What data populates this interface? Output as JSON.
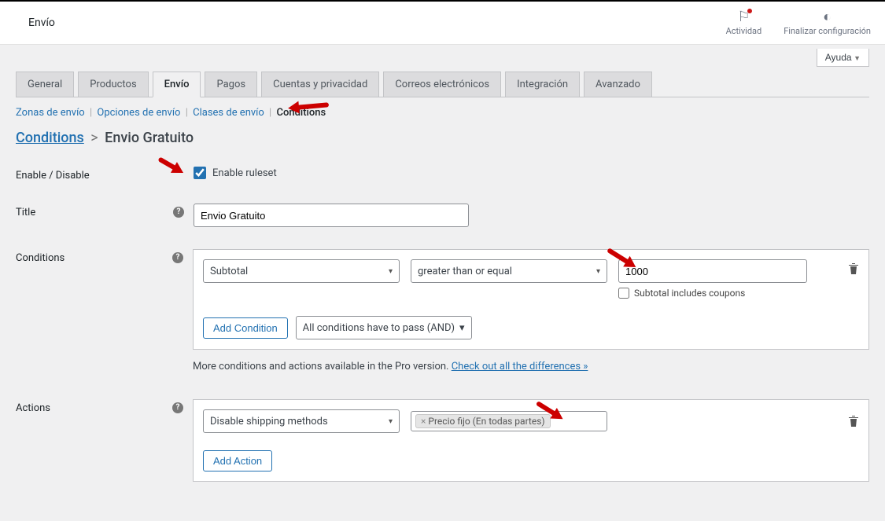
{
  "header": {
    "title": "Envío",
    "actividad_label": "Actividad",
    "finalizar_label": "Finalizar configuración",
    "help_label": "Ayuda"
  },
  "tabs": {
    "items": [
      {
        "label": "General",
        "active": false
      },
      {
        "label": "Productos",
        "active": false
      },
      {
        "label": "Envío",
        "active": true
      },
      {
        "label": "Pagos",
        "active": false
      },
      {
        "label": "Cuentas y privacidad",
        "active": false
      },
      {
        "label": "Correos electrónicos",
        "active": false
      },
      {
        "label": "Integración",
        "active": false
      },
      {
        "label": "Avanzado",
        "active": false
      }
    ]
  },
  "subtabs": {
    "zonas": "Zonas de envío",
    "opciones": "Opciones de envío",
    "clases": "Clases de envío",
    "conditions": "Conditions"
  },
  "breadcrumb": {
    "root": "Conditions",
    "current": "Envio Gratuito"
  },
  "form": {
    "enable_label": "Enable / Disable",
    "enable_checkbox_label": "Enable ruleset",
    "enable_checked": true,
    "title_label": "Title",
    "title_value": "Envio Gratuito",
    "conditions_label": "Conditions",
    "actions_label": "Actions"
  },
  "condition": {
    "field": "Subtotal",
    "operator": "greater than or equal",
    "value": "1000",
    "sub_option_label": "Subtotal includes coupons",
    "sub_option_checked": false,
    "add_button": "Add Condition",
    "logic_selector": "All conditions have to pass (AND)"
  },
  "pro_note": {
    "text": "More conditions and actions available in the Pro version. ",
    "link": "Check out all the differences »"
  },
  "action": {
    "type": "Disable shipping methods",
    "tag": "Precio fijo (En todas partes)",
    "add_button": "Add Action"
  }
}
